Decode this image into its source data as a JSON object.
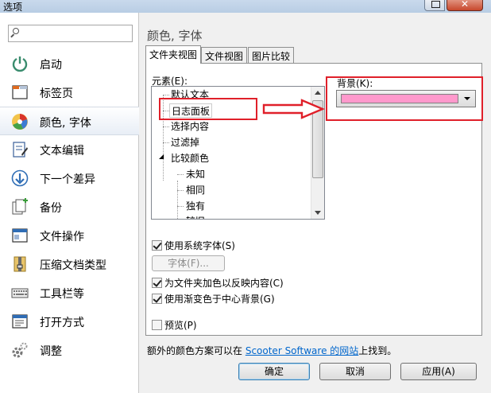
{
  "window": {
    "title": "选项"
  },
  "sidebar": {
    "search_placeholder": "",
    "items": [
      {
        "label": "启动",
        "icon": "power-icon",
        "active": false
      },
      {
        "label": "标签页",
        "icon": "tab-page-icon",
        "active": false
      },
      {
        "label": "颜色, 字体",
        "icon": "color-palette-icon",
        "active": true
      },
      {
        "label": "文本编辑",
        "icon": "text-edit-icon",
        "active": false
      },
      {
        "label": "下一个差异",
        "icon": "next-difference-icon",
        "active": false
      },
      {
        "label": "备份",
        "icon": "backup-icon",
        "active": false
      },
      {
        "label": "文件操作",
        "icon": "file-operation-icon",
        "active": false
      },
      {
        "label": "压缩文档类型",
        "icon": "archive-icon",
        "active": false
      },
      {
        "label": "工具栏等",
        "icon": "keyboard-icon",
        "active": false
      },
      {
        "label": "打开方式",
        "icon": "open-with-icon",
        "active": false
      },
      {
        "label": "调整",
        "icon": "gear-icon",
        "active": false
      }
    ]
  },
  "panel": {
    "header": "颜色, 字体",
    "tabs": [
      "文件夹视图",
      "文件视图",
      "图片比较"
    ],
    "active_tab": 0,
    "elements_label": "元素(E):",
    "tree": [
      {
        "label": "默认文本",
        "level": 1
      },
      {
        "label": "日志面板",
        "level": 1,
        "selected": true
      },
      {
        "label": "选择内容",
        "level": 1
      },
      {
        "label": "过滤掉",
        "level": 1
      },
      {
        "label": "比较颜色",
        "level": 1,
        "expanded": true
      },
      {
        "label": "未知",
        "level": 2
      },
      {
        "label": "相同",
        "level": 2
      },
      {
        "label": "独有",
        "level": 2
      },
      {
        "label": "较旧",
        "level": 2
      }
    ],
    "background_label": "背景(K):",
    "background_color": "#ff99cc",
    "use_system_font": {
      "label": "使用系统字体(S)",
      "checked": true
    },
    "font_button": "字体(F)...",
    "color_folders": {
      "label": "为文件夹加色以反映内容(C)",
      "checked": true
    },
    "gradient_bg": {
      "label": "使用渐变色于中心背景(G)",
      "checked": true
    },
    "preview": {
      "label": "预览(P)",
      "checked": false
    },
    "footer_prefix": "额外的颜色方案可以在 ",
    "footer_link": "Scooter Software 的网站",
    "footer_suffix": "上找到。"
  },
  "buttons": {
    "ok": "确定",
    "cancel": "取消",
    "apply": "应用(A)"
  },
  "colors": {
    "annotation_red": "#e0202a",
    "selection_bg": "#ffffff",
    "link": "#0066cc"
  }
}
